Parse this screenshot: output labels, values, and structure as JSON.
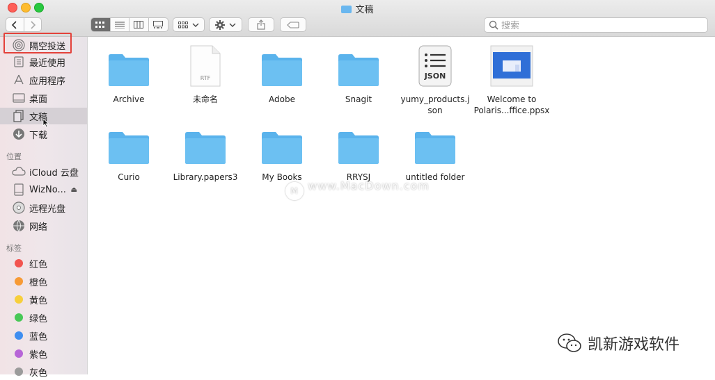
{
  "window": {
    "title": "文稿"
  },
  "toolbar": {
    "back": "‹",
    "forward": "›",
    "search_placeholder": "搜索"
  },
  "sidebar": {
    "favorites": [
      {
        "label": "隔空投送",
        "icon": "airdrop-icon"
      },
      {
        "label": "最近使用",
        "icon": "recents-icon"
      },
      {
        "label": "应用程序",
        "icon": "applications-icon"
      },
      {
        "label": "桌面",
        "icon": "desktop-icon"
      },
      {
        "label": "文稿",
        "icon": "documents-icon"
      },
      {
        "label": "下载",
        "icon": "downloads-icon"
      }
    ],
    "locations_header": "位置",
    "locations": [
      {
        "label": "iCloud 云盘",
        "icon": "cloud-icon"
      },
      {
        "label": "WizNo...",
        "icon": "disk-icon"
      },
      {
        "label": "远程光盘",
        "icon": "disc-icon"
      },
      {
        "label": "网络",
        "icon": "network-icon"
      }
    ],
    "tags_header": "标签",
    "tags": [
      {
        "label": "红色",
        "color": "#f2544f"
      },
      {
        "label": "橙色",
        "color": "#f79a35"
      },
      {
        "label": "黄色",
        "color": "#f7cf3c"
      },
      {
        "label": "绿色",
        "color": "#48c857"
      },
      {
        "label": "蓝色",
        "color": "#3f8ef0"
      },
      {
        "label": "紫色",
        "color": "#b765d7"
      },
      {
        "label": "灰色",
        "color": "#9b9b9b"
      }
    ]
  },
  "files": [
    {
      "name": "Archive",
      "type": "folder"
    },
    {
      "name": "未命名",
      "type": "rtf",
      "badge": "RTF"
    },
    {
      "name": "Adobe",
      "type": "folder"
    },
    {
      "name": "Snagit",
      "type": "folder"
    },
    {
      "name": "yumy_products.json",
      "type": "json",
      "badge": "JSON"
    },
    {
      "name": "Welcome to Polaris...ffice.ppsx",
      "type": "ppsx"
    },
    {
      "name": "Curio",
      "type": "folder"
    },
    {
      "name": "Library.papers3",
      "type": "folder"
    },
    {
      "name": "My Books",
      "type": "folder"
    },
    {
      "name": "RRYSJ",
      "type": "folder"
    },
    {
      "name": "untitled folder",
      "type": "folder"
    }
  ],
  "overlay": {
    "watermark": "www.MacDown.com",
    "brand": "凯新游戏软件"
  },
  "colors": {
    "folder": "#6cc0f2",
    "folder_tab": "#5ab3ec",
    "highlight": "#e3413a"
  }
}
